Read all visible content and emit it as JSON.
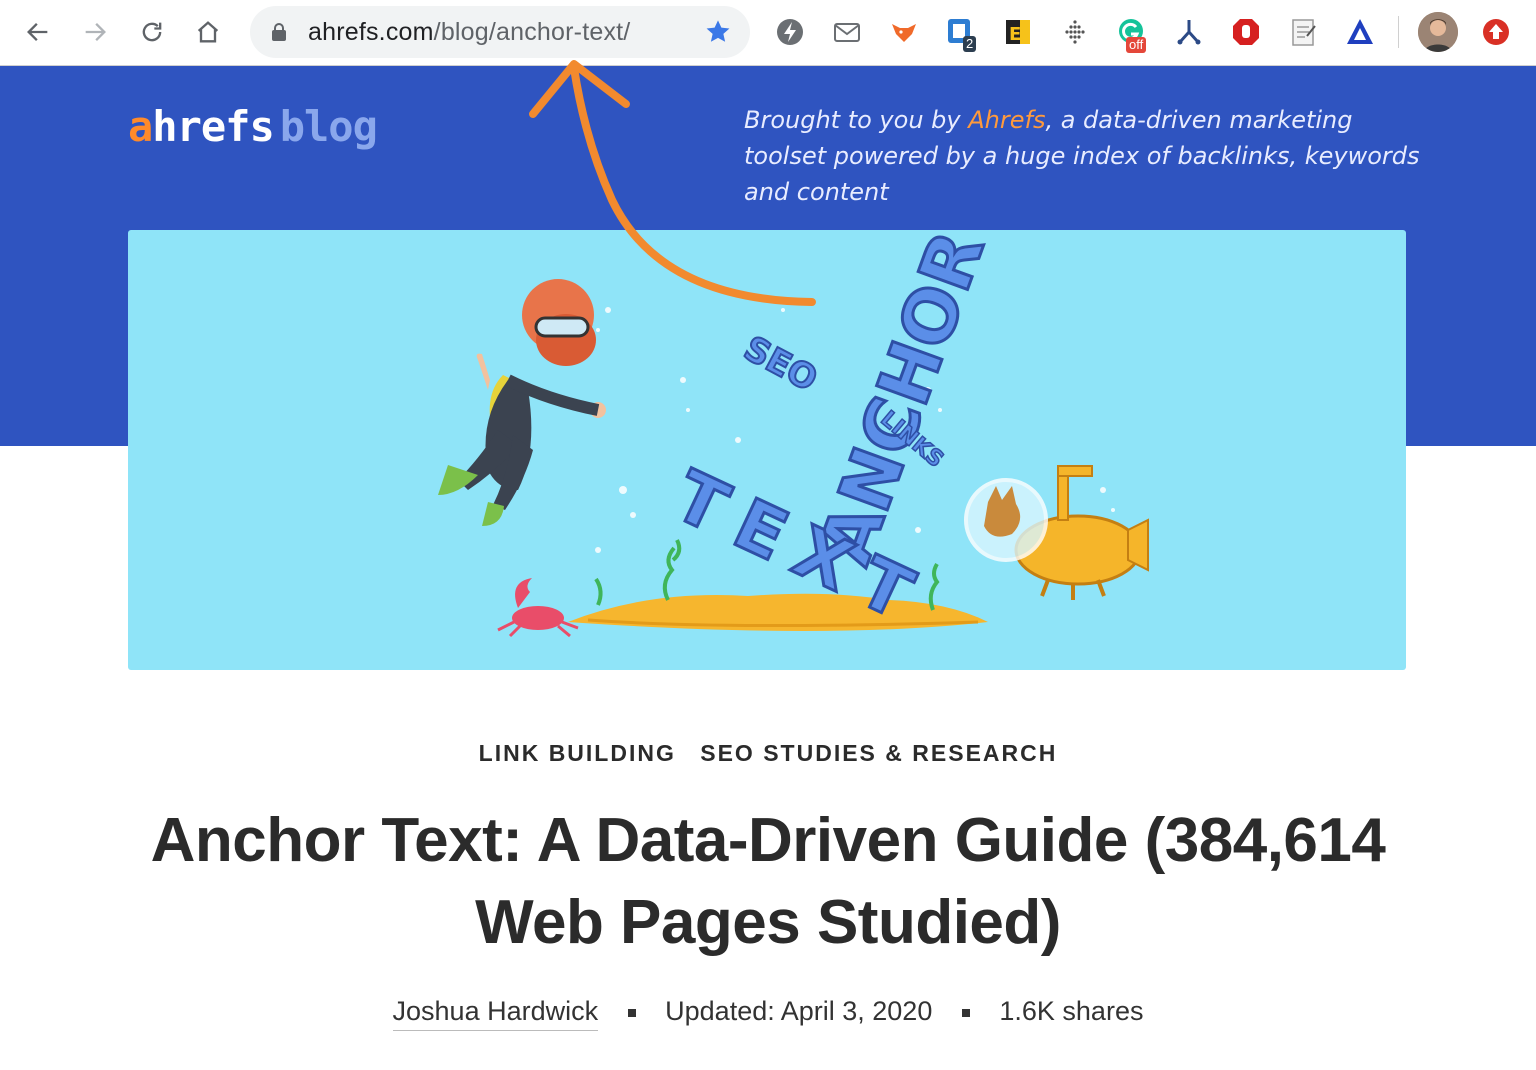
{
  "browser": {
    "url_host": "ahrefs.com",
    "url_path": "/blog/anchor-text/",
    "extensions": [
      {
        "name": "lightning-extension-icon"
      },
      {
        "name": "mail-extension-icon"
      },
      {
        "name": "fox-extension-icon"
      },
      {
        "name": "tab-counter-extension-icon",
        "badge": "2"
      },
      {
        "name": "e-extension-icon"
      },
      {
        "name": "dots-extension-icon"
      },
      {
        "name": "grammarly-extension-icon",
        "badge": "off"
      },
      {
        "name": "fork-extension-icon"
      },
      {
        "name": "stop-hand-extension-icon"
      },
      {
        "name": "notes-extension-icon"
      },
      {
        "name": "triangle-extension-icon"
      }
    ]
  },
  "header": {
    "logo_a": "a",
    "logo_hrefs": "hrefs",
    "logo_blog": "blog",
    "tagline_prefix": "Brought to you by ",
    "tagline_brand": "Ahrefs",
    "tagline_rest": ", a data-driven marketing toolset powered by a huge index of backlinks, keywords and content"
  },
  "hero": {
    "words": [
      "SEO",
      "ANCHOR",
      "LINKS",
      "TEXT"
    ]
  },
  "article": {
    "categories": [
      "LINK BUILDING",
      "SEO STUDIES & RESEARCH"
    ],
    "title": "Anchor Text: A Data-Driven Guide (384,614 Web Pages Studied)",
    "author": "Joshua Hardwick",
    "updated": "Updated: April 3, 2020",
    "shares": "1.6K shares"
  },
  "colors": {
    "header_blue": "#2f54c0",
    "hero_bg": "#8fe4f8",
    "accent_orange": "#ff8a2a",
    "annotation_arrow": "#f28a2e"
  }
}
